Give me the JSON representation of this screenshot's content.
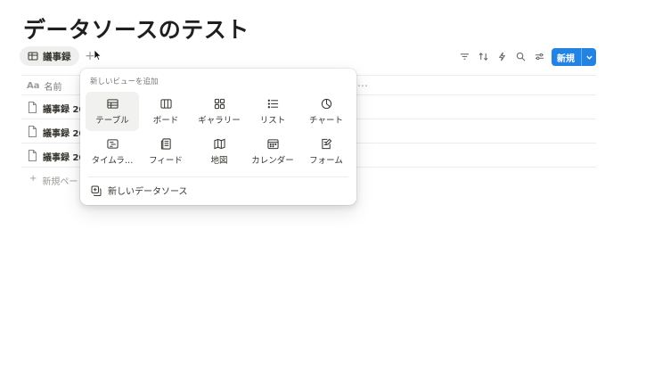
{
  "page": {
    "title": "データソースのテスト"
  },
  "view_tab": {
    "label": "議事録",
    "icon": "table-icon"
  },
  "toolbar": {
    "icons": [
      "filter-icon",
      "sort-icon",
      "lightning-icon",
      "search-icon",
      "settings-sliders-icon"
    ],
    "new_label": "新規"
  },
  "table": {
    "column_name": "名前",
    "column_icon": "Aa",
    "more": "…",
    "rows": [
      {
        "text": "議事録 20"
      },
      {
        "text": "議事録 20"
      },
      {
        "text": "議事録 20"
      }
    ],
    "add_label": "新規ペー"
  },
  "popup": {
    "heading": "新しいビューを追加",
    "options": [
      {
        "label": "テーブル",
        "icon": "table-icon",
        "selected": true
      },
      {
        "label": "ボード",
        "icon": "board-icon"
      },
      {
        "label": "ギャラリー",
        "icon": "gallery-icon"
      },
      {
        "label": "リスト",
        "icon": "list-icon"
      },
      {
        "label": "チャート",
        "icon": "chart-icon"
      },
      {
        "label": "タイムラ…",
        "icon": "timeline-icon"
      },
      {
        "label": "フィード",
        "icon": "feed-icon"
      },
      {
        "label": "地図",
        "icon": "map-icon"
      },
      {
        "label": "カレンダー",
        "icon": "calendar-icon"
      },
      {
        "label": "フォーム",
        "icon": "form-icon"
      }
    ],
    "new_source": "新しいデータソース"
  },
  "colors": {
    "accent": "#2383e2"
  }
}
